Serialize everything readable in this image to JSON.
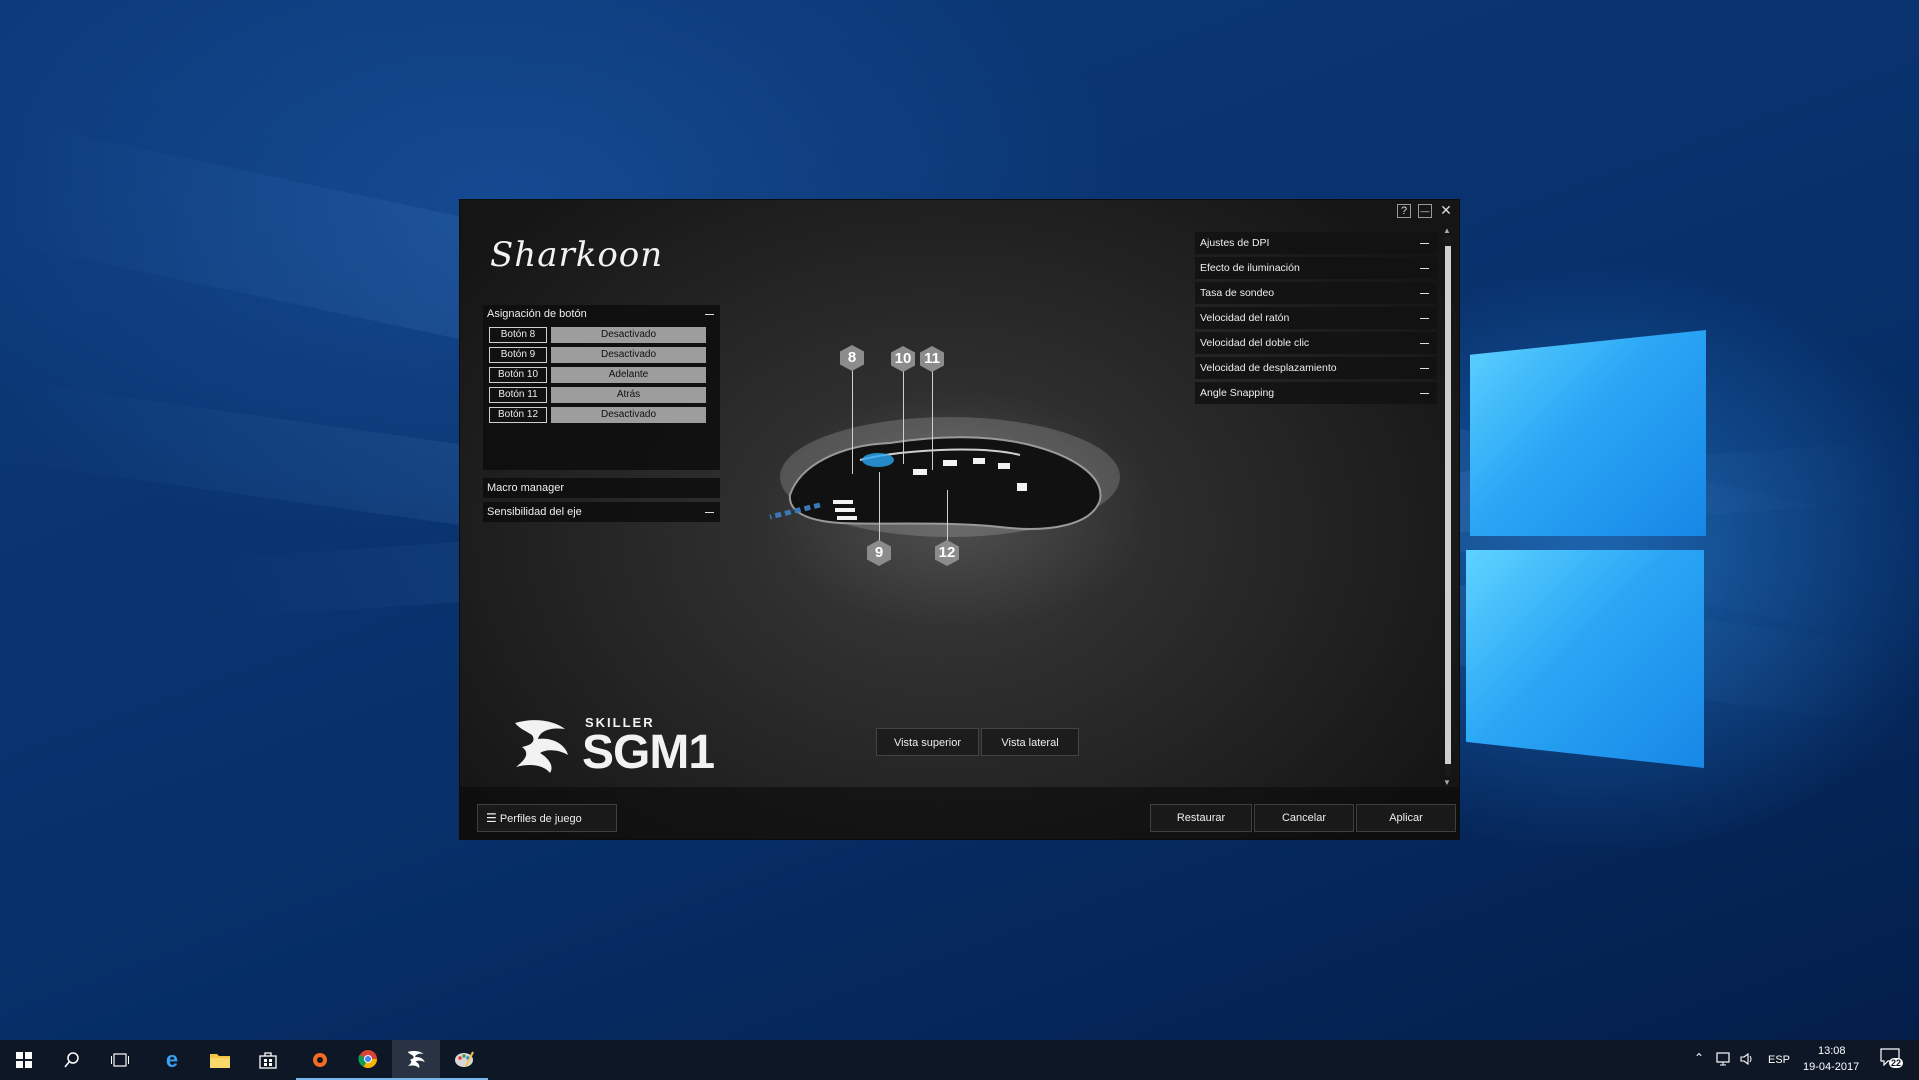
{
  "app": {
    "brand": "Sharkoon",
    "window_controls": {
      "help": "?",
      "minimize": "—",
      "close": "✕"
    },
    "button_assignment": {
      "title": "Asignación de botón",
      "rows": [
        {
          "name": "Botón 8",
          "value": "Desactivado"
        },
        {
          "name": "Botón 9",
          "value": "Desactivado"
        },
        {
          "name": "Botón 10",
          "value": "Adelante"
        },
        {
          "name": "Botón 11",
          "value": "Atrás"
        },
        {
          "name": "Botón 12",
          "value": "Desactivado"
        }
      ]
    },
    "macro_manager": "Macro manager",
    "axis_sensitivity": "Sensibilidad del eje",
    "right_panels": [
      "Ajustes de DPI",
      "Efecto de iluminación",
      "Tasa de sondeo",
      "Velocidad del ratón",
      "Velocidad del doble clic",
      "Velocidad de desplazamiento",
      "Angle Snapping"
    ],
    "callouts": [
      "8",
      "10",
      "11",
      "9",
      "12"
    ],
    "product": {
      "line": "SKILLER",
      "model": "SGM1"
    },
    "views": {
      "top": "Vista superior",
      "side": "Vista lateral"
    },
    "footer": {
      "profiles": "Perfiles de juego",
      "restore": "Restaurar",
      "cancel": "Cancelar",
      "apply": "Aplicar"
    }
  },
  "taskbar": {
    "language": "ESP",
    "time": "13:08",
    "date": "19-04-2017",
    "notifications": "22"
  }
}
